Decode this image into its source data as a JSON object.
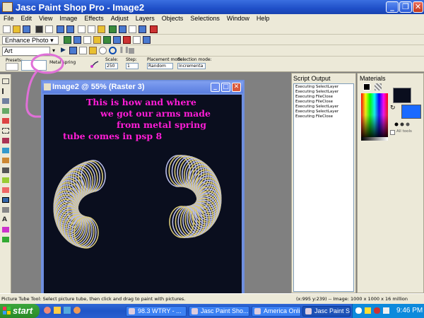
{
  "app": {
    "title": "Jasc Paint Shop Pro - Image2"
  },
  "menu": [
    "File",
    "Edit",
    "View",
    "Image",
    "Effects",
    "Adjust",
    "Layers",
    "Objects",
    "Selections",
    "Window",
    "Help"
  ],
  "toolbars": {
    "enhance_label": "Enhance Photo",
    "art_select": "Art"
  },
  "tool_options": {
    "presets_label": "Presets:",
    "tube_name": "Metal spring",
    "scale_label": "Scale:",
    "scale_value": "250",
    "step_label": "Step:",
    "step_value": "1",
    "placement_label": "Placement mode:",
    "placement_value": "Random",
    "selection_label": "Selection mode:",
    "selection_value": "Incrementa"
  },
  "image_window": {
    "title": "Image2 @  55% (Raster 3)",
    "caption_lines": [
      "This is how and where",
      "we got our arms made",
      "from metal spring",
      "tube comes in psp 8"
    ]
  },
  "script_output": {
    "title": "Script Output",
    "lines": [
      "Executing SelectLayer",
      "Executing SelectLayer",
      "Executing FileClose",
      "Executing FileClose",
      "Executing SelectLayer",
      "Executing SelectLayer",
      "Executing FileClose"
    ]
  },
  "materials": {
    "title": "Materials",
    "all_tools": "All tools"
  },
  "status": {
    "left": "Picture Tube Tool: Select picture tube, then click and drag to paint with pictures.",
    "right": "(x:995 y:239) -- Image:  1000 x 1000 x 16 million"
  },
  "taskbar": {
    "start": "start",
    "tasks": [
      "98.3 WTRY - ...",
      "Jasc Paint Sho...",
      "America  Onli...",
      "Jasc Paint Sho..."
    ],
    "clock": "9:46 PM"
  },
  "colors": {
    "caption": "#ff1dd6",
    "annotation": "#e070d8",
    "xp_blue": "#2a5fcf"
  }
}
